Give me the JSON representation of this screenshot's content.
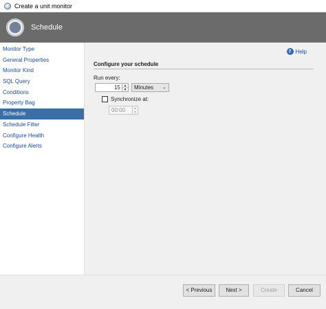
{
  "window": {
    "title": "Create a unit monitor"
  },
  "banner": {
    "title": "Schedule"
  },
  "nav": {
    "items": [
      {
        "label": "Monitor Type"
      },
      {
        "label": "General Properties"
      },
      {
        "label": "Monitor Kind"
      },
      {
        "label": "SQL Query"
      },
      {
        "label": "Conditions"
      },
      {
        "label": "Property Bag"
      },
      {
        "label": "Schedule",
        "active": true
      },
      {
        "label": "Schedule Filter"
      },
      {
        "label": "Configure Health"
      },
      {
        "label": "Configure Alerts"
      }
    ]
  },
  "help": {
    "label": "Help",
    "icon": "help-icon"
  },
  "schedule": {
    "section_title": "Configure your schedule",
    "run_every_label": "Run every:",
    "interval_value": "15",
    "units_value": "Minutes",
    "synchronize_label": "Synchronize at:",
    "synchronize_checked": false,
    "sync_time_value": "00:00"
  },
  "footer": {
    "previous_label": "< Previous",
    "next_label": "Next >",
    "create_label": "Create",
    "cancel_label": "Cancel"
  },
  "colors": {
    "banner": "#6b6b6b",
    "nav_active": "#3a6ea5",
    "link": "#1a4a8c"
  }
}
